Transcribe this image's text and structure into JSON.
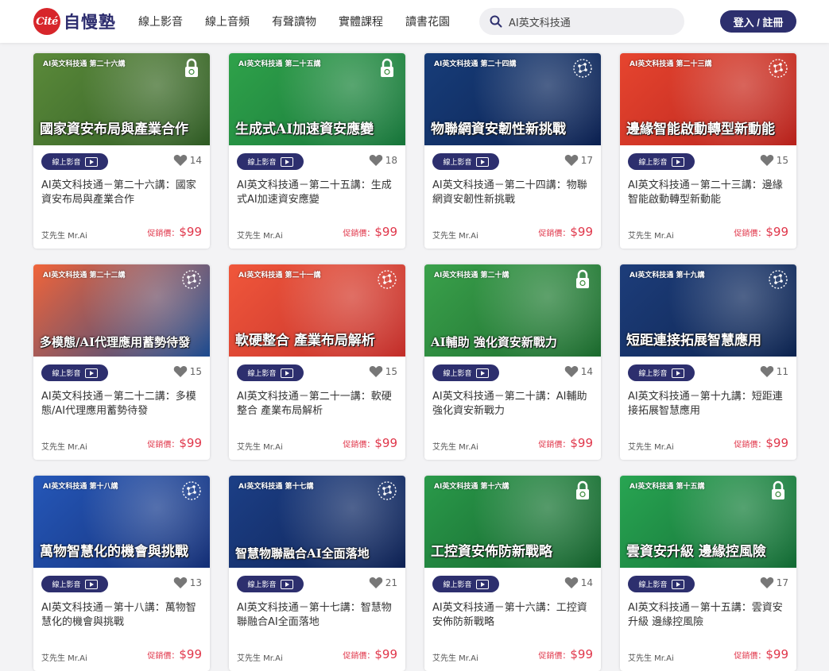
{
  "header": {
    "logo_badge": "Cité",
    "logo_text": "自慢塾",
    "nav": [
      "線上影音",
      "線上音頻",
      "有聲讀物",
      "實體課程",
      "讀書花園"
    ],
    "search": {
      "value": "AI英文科技通"
    },
    "login_label": "登入 / 註冊"
  },
  "common": {
    "tag_label": "線上影音",
    "author": "艾先生 Mr.Ai",
    "price_label": "促銷價：",
    "price": "$99"
  },
  "cards": [
    {
      "series": "AI英文科技通 第二十六講",
      "headline": "國家資安布局與產業合作",
      "likes": "14",
      "title": "AI英文科技通－第二十六講：國家資安布局與產業合作",
      "bg": "#5b8a3a",
      "bg2": "#2f5b24",
      "icon": "lock-fingerprint-icon"
    },
    {
      "series": "AI英文科技通 第二十五講",
      "headline": "生成式AI加速資安應變",
      "likes": "18",
      "title": "AI英文科技通－第二十五講：生成式AI加速資安應變",
      "bg": "#2fa24a",
      "bg2": "#17753a",
      "icon": "lock-fingerprint-icon"
    },
    {
      "series": "AI英文科技通 第二十四講",
      "headline": "物聯網資安韌性新挑戰",
      "likes": "17",
      "title": "AI英文科技通－第二十四講：物聯網資安韌性新挑戰",
      "bg": "#173d79",
      "bg2": "#0c2151",
      "icon": "network-head-icon"
    },
    {
      "series": "AI英文科技通 第二十三講",
      "headline": "邊緣智能啟動轉型新動能",
      "likes": "15",
      "title": "AI英文科技通－第二十三講：邊緣智能啟動轉型新動能",
      "bg": "#e6452f",
      "bg2": "#b7221c",
      "icon": "network-head-icon"
    },
    {
      "series": "AI英文科技通 第二十二講",
      "headline": "多模態/AI代理應用蓄勢待發",
      "likes": "15",
      "title": "AI英文科技通－第二十二講：多模態/AI代理應用蓄勢待發",
      "bg": "#f0643a",
      "bg2": "#1d4b8f",
      "icon": "network-head-icon"
    },
    {
      "series": "AI英文科技通 第二十一講",
      "headline": "軟硬整合 產業布局解析",
      "likes": "15",
      "title": "AI英文科技通－第二十一講：軟硬整合 產業布局解析",
      "bg": "#f0573b",
      "bg2": "#c22e2a",
      "icon": "network-head-icon"
    },
    {
      "series": "AI英文科技通 第二十講",
      "headline": "AI輔助 強化資安新戰力",
      "likes": "14",
      "title": "AI英文科技通－第二十講：AI輔助 強化資安新戰力",
      "bg": "#3aa14b",
      "bg2": "#1c6a2e",
      "icon": "lock-fingerprint-icon"
    },
    {
      "series": "AI英文科技通 第十九講",
      "headline": "短距連接拓展智慧應用",
      "likes": "11",
      "title": "AI英文科技通－第十九講：短距連接拓展智慧應用",
      "bg": "#1d3d7a",
      "bg2": "#0d2450",
      "icon": "network-head-icon"
    },
    {
      "series": "AI英文科技通 第十八講",
      "headline": "萬物智慧化的機會與挑戰",
      "likes": "13",
      "title": "AI英文科技通－第十八講：萬物智慧化的機會與挑戰",
      "bg": "#2557b8",
      "bg2": "#142f76",
      "icon": "network-head-icon"
    },
    {
      "series": "AI英文科技通 第十七講",
      "headline": "智慧物聯融合AI全面落地",
      "likes": "21",
      "title": "AI英文科技通－第十七講：智慧物聯融合AI全面落地",
      "bg": "#1c3f86",
      "bg2": "#0e2254",
      "icon": "network-head-icon"
    },
    {
      "series": "AI英文科技通 第十六講",
      "headline": "工控資安佈防新戰略",
      "likes": "14",
      "title": "AI英文科技通－第十六講：工控資安佈防新戰略",
      "bg": "#2a9a4a",
      "bg2": "#14602c",
      "icon": "lock-fingerprint-icon"
    },
    {
      "series": "AI英文科技通 第十五講",
      "headline": "雲資安升級 邊緣控風險",
      "likes": "17",
      "title": "AI英文科技通－第十五講：雲資安升級 邊緣控風險",
      "bg": "#28a552",
      "bg2": "#136a34",
      "icon": "lock-fingerprint-icon"
    }
  ]
}
